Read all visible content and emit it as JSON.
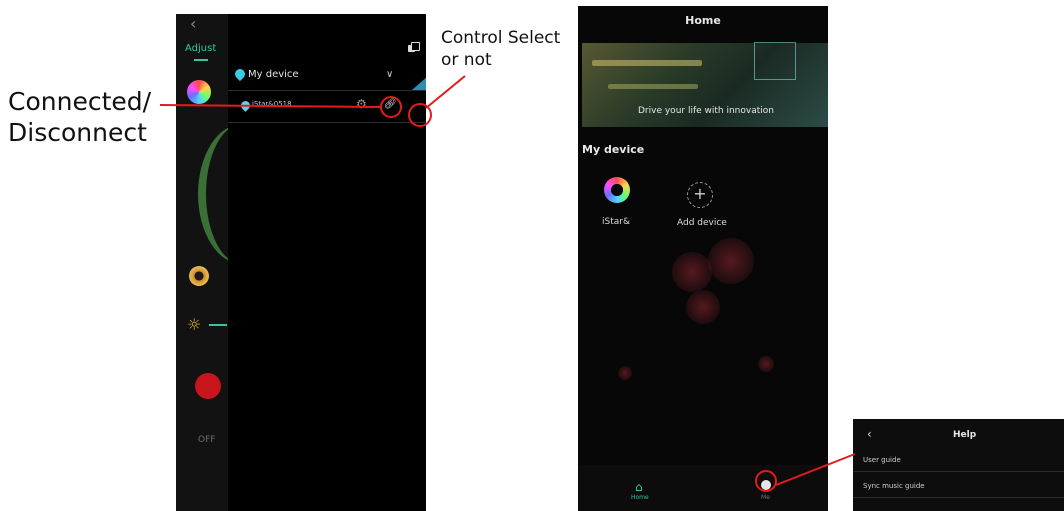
{
  "annotations": {
    "connected_label_line1": "Connected/",
    "connected_label_line2": "Disconnect",
    "control_label_line1": "Control Select",
    "control_label_line2": "or not",
    "accent_color": "#e51b1b"
  },
  "left_screen": {
    "back_icon": "chevron-left-icon",
    "tab_label": "Adjust",
    "off_label": "OFF",
    "group_label": "My device",
    "device_name": "iStar&0518",
    "accent_color": "#2fc8a0"
  },
  "home_screen": {
    "title": "Home",
    "banner_text": "Drive your life with innovation",
    "section_title": "My device",
    "devices": [
      {
        "label": "iStar&",
        "icon": "rainbow-ring-icon"
      },
      {
        "label": "Add device",
        "icon": "plus-circle-icon"
      }
    ],
    "nav": {
      "home_label": "Home",
      "me_label": "Me"
    }
  },
  "help_screen": {
    "title": "Help",
    "items": [
      "User guide",
      "Sync music guide"
    ]
  }
}
